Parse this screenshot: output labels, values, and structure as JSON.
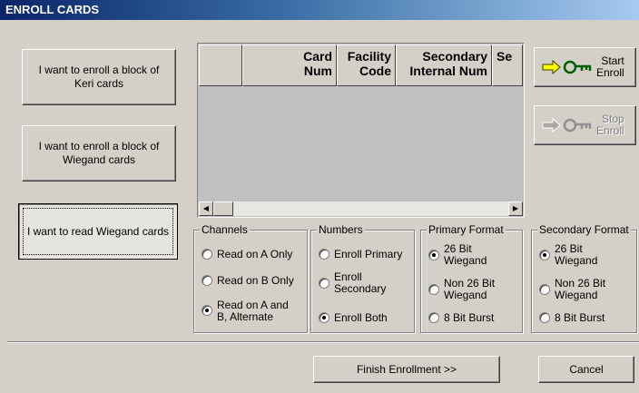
{
  "window": {
    "title": "ENROLL CARDS"
  },
  "modes": [
    {
      "label": "I want to enroll a block of Keri cards"
    },
    {
      "label": "I want to enroll a block of Wiegand cards"
    },
    {
      "label": "I want to read Wiegand cards"
    }
  ],
  "grid": {
    "columns": [
      "",
      "Card\nNum",
      "Facility\nCode",
      "Secondary\nInternal Num",
      "Se"
    ]
  },
  "actions": {
    "start_enroll": "Start\nEnroll",
    "stop_enroll": "Stop\nEnroll",
    "finish": "Finish Enrollment >>",
    "cancel": "Cancel"
  },
  "groups": {
    "channels": {
      "title": "Channels",
      "options": [
        "Read on A Only",
        "Read on B Only",
        "Read on A and\nB, Alternate"
      ],
      "selected": 2
    },
    "numbers": {
      "title": "Numbers",
      "options": [
        "Enroll Primary",
        "Enroll\nSecondary",
        "Enroll Both"
      ],
      "selected": 2
    },
    "primary_format": {
      "title": "Primary Format",
      "options": [
        "26 Bit\nWiegand",
        "Non 26 Bit\nWiegand",
        "8 Bit Burst"
      ],
      "selected": 0
    },
    "secondary_format": {
      "title": "Secondary Format",
      "options": [
        "26 Bit\nWiegand",
        "Non 26 Bit\nWiegand",
        "8 Bit Burst"
      ],
      "selected": 0
    }
  },
  "colors": {
    "title_bar": "#0a246a",
    "key_icon": "#ffff00",
    "key_outline": "#006000"
  }
}
